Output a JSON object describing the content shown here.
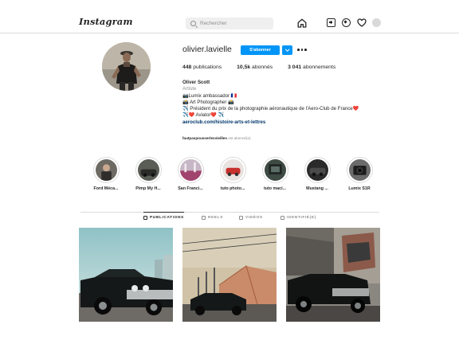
{
  "header": {
    "logo": "Instagram",
    "search_placeholder": "Rechercher"
  },
  "profile": {
    "username": "olivier.lavielle",
    "follow_label": "S'abonner",
    "stats": {
      "publications": "448",
      "publications_label": "publications",
      "followers": "10,5k",
      "followers_label": "abonnés",
      "following": "3 041",
      "following_label": "abonnements"
    },
    "bio": {
      "name": "Oliver Scott",
      "category": "Artiste",
      "line1": "📷Lumix ambassador 🇫🇷",
      "line2": "📸 Art Photographer 📸",
      "line3": "✈️ Président du prix de la photographie aéronautique de l'Aero-Club de France❤️",
      "line4": "✈️❤️ Aviator❤️ ✈️",
      "link": "aeroclub.com/histoire-arts-et-lettres"
    },
    "followed_by_name": "fautpaspousserlesvieilles",
    "followed_by_suffix": "est abonné(e)"
  },
  "highlights": [
    {
      "label": "Ford Méca..."
    },
    {
      "label": "Pimp My H..."
    },
    {
      "label": "San Franci..."
    },
    {
      "label": "tuto photo..."
    },
    {
      "label": "tuto maci..."
    },
    {
      "label": "Mustang ..."
    },
    {
      "label": "Lumix S1R"
    }
  ],
  "tabs": [
    {
      "label": "PUBLICATIONS"
    },
    {
      "label": "REELS"
    },
    {
      "label": "VIDÉOS"
    },
    {
      "label": "IDENTIFIÉ(E)"
    }
  ],
  "colors": {
    "accent": "#0095f6",
    "link": "#00376b",
    "muted": "#8e8e8e",
    "border": "#dbdbdb"
  }
}
